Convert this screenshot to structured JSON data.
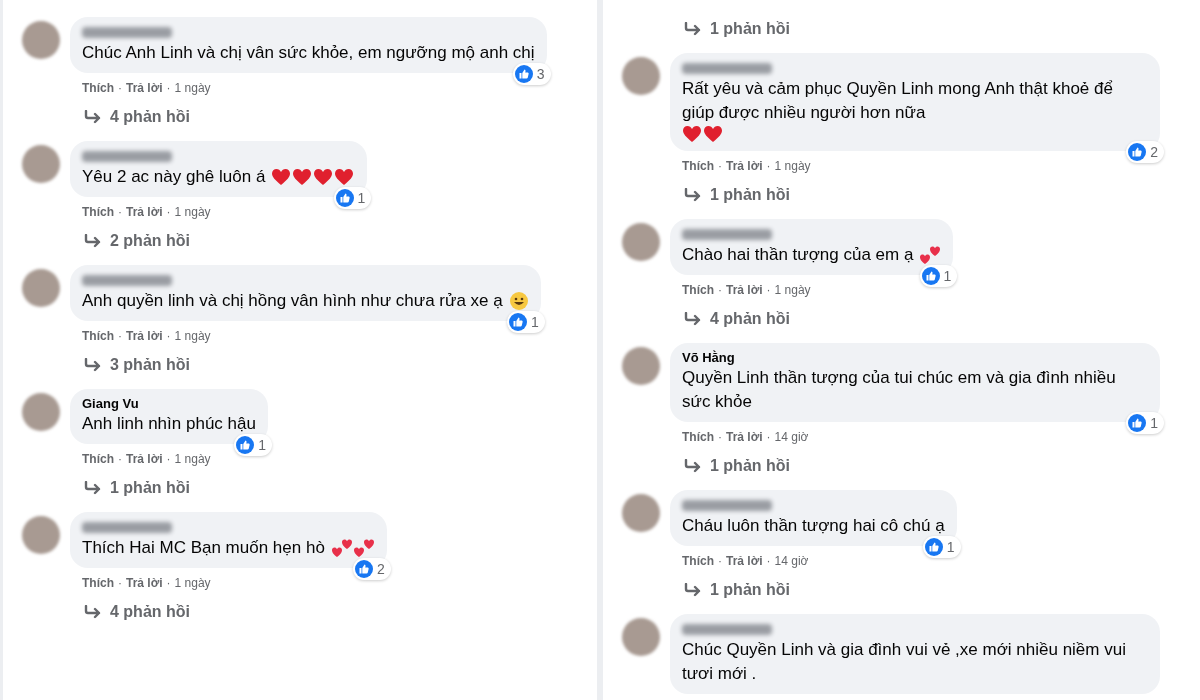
{
  "columns": [
    {
      "comments": [
        {
          "name_blurred": true,
          "text": "Chúc Anh Linh và chị vân sức khỏe, em ngưỡng mộ anh chị",
          "likes": "3",
          "actions": {
            "like": "Thích",
            "separator": "·",
            "reply": "Trả lời",
            "time": "1 ngày"
          },
          "replies": "4 phản hồi"
        },
        {
          "name_blurred": true,
          "text": "Yêu 2 ac này ghê luôn á",
          "emojis": [
            {
              "kind": "heart"
            },
            {
              "kind": "heart"
            },
            {
              "kind": "heart"
            },
            {
              "kind": "heart"
            }
          ],
          "likes": "1",
          "actions": {
            "like": "Thích",
            "separator": "·",
            "reply": "Trả lời",
            "time": "1 ngày"
          },
          "replies": "2 phản hồi"
        },
        {
          "name_blurred": true,
          "text": "Anh quyền linh và chị hồng vân hình như chưa rửa xe ạ",
          "emojis": [
            {
              "kind": "smile"
            }
          ],
          "likes": "1",
          "actions": {
            "like": "Thích",
            "separator": "·",
            "reply": "Trả lời",
            "time": "1 ngày"
          },
          "replies": "3 phản hồi"
        },
        {
          "name": "Giang Vu",
          "name_blurred": false,
          "text": "Anh linh nhìn phúc hậu",
          "likes": "1",
          "actions": {
            "like": "Thích",
            "separator": "·",
            "reply": "Trả lời",
            "time": "1 ngày"
          },
          "replies": "1 phản hồi"
        },
        {
          "name_blurred": true,
          "text": "Thích Hai MC Bạn muốn hẹn hò",
          "emojis": [
            {
              "kind": "two-hearts"
            },
            {
              "kind": "two-hearts"
            }
          ],
          "likes": "2",
          "actions": {
            "like": "Thích",
            "separator": "·",
            "reply": "Trả lời",
            "time": "1 ngày"
          },
          "replies": "4 phản hồi"
        }
      ]
    },
    {
      "leading_replies": "1 phản hồi",
      "comments": [
        {
          "name_blurred": true,
          "text": "Rất yêu và cảm phục Quyền Linh mong Anh thật khoẻ để giúp được nhiều người hơn nữa",
          "emojis": [
            {
              "kind": "heart"
            },
            {
              "kind": "heart"
            }
          ],
          "likes": "2",
          "actions": {
            "like": "Thích",
            "separator": "·",
            "reply": "Trả lời",
            "time": "1 ngày"
          },
          "replies": "1 phản hồi"
        },
        {
          "name_blurred": true,
          "text": "Chào hai thần tượng của em ạ",
          "emojis": [
            {
              "kind": "two-hearts"
            }
          ],
          "likes": "1",
          "actions": {
            "like": "Thích",
            "separator": "·",
            "reply": "Trả lời",
            "time": "1 ngày"
          },
          "replies": "4 phản hồi"
        },
        {
          "name": "Võ Hằng",
          "name_blurred": false,
          "text": "Quyền Linh thần tượng của tui chúc em và gia đình nhiều sức khỏe",
          "likes": "1",
          "actions": {
            "like": "Thích",
            "separator": "·",
            "reply": "Trả lời",
            "time": "14 giờ"
          },
          "replies": "1 phản hồi"
        },
        {
          "name_blurred": true,
          "text": "Cháu luôn thần tượng hai cô chú ạ",
          "likes": "1",
          "actions": {
            "like": "Thích",
            "separator": "·",
            "reply": "Trả lời",
            "time": "14 giờ"
          },
          "replies": "1 phản hồi"
        },
        {
          "name_blurred": true,
          "text": "Chúc Quyền Linh và gia đình vui vẻ ,xe mới nhiều niềm vui tươi mới ."
        }
      ]
    }
  ]
}
